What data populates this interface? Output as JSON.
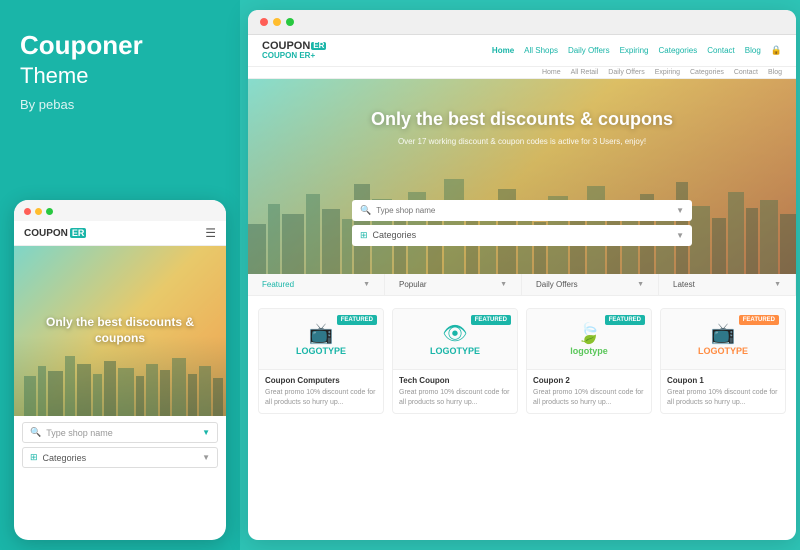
{
  "left": {
    "title": "Couponer",
    "subtitle": "Theme",
    "author": "By pebas"
  },
  "mobile": {
    "logo": "COUPON",
    "logo_er": "ER",
    "hero_text": "Only the best discounts & coupons",
    "search_placeholder": "Type shop name",
    "categories_label": "Categories"
  },
  "desktop": {
    "logo_main": "COUPON",
    "logo_er": "ER",
    "logo_sub": "COUPON ER+",
    "nav_links": [
      "Home",
      "All Shops",
      "Daily Offers",
      "Expiring",
      "Categories",
      "Contact",
      "Blog"
    ],
    "hero_title": "Only the best discounts & coupons",
    "hero_subtitle": "Over 17 working discount & coupon codes is active for 3 Users, enjoy!",
    "search_placeholder": "Type shop name",
    "categories_label": "Categories",
    "filter_tabs": [
      "Featured",
      "Popular",
      "Daily Offers",
      "Latest"
    ],
    "cards": [
      {
        "title": "Coupon Computers",
        "desc": "Great promo 10% discount code for all products so hurry up...",
        "logotype": "LOGOTYPE",
        "logotype_color": "teal",
        "badge": "FEATURED",
        "badge_color": "teal"
      },
      {
        "title": "Tech Coupon",
        "desc": "Great promo 10% discount code for all products so hurry up...",
        "logotype": "LOGOTYPE",
        "logotype_color": "teal",
        "badge": "FEATURED",
        "badge_color": "teal"
      },
      {
        "title": "Coupon 2",
        "desc": "Great promo 10% discount code for all products so hurry up...",
        "logotype": "logotype",
        "logotype_color": "green",
        "badge": "FEATURED",
        "badge_color": "teal"
      },
      {
        "title": "Coupon 1",
        "desc": "Great promo 10% discount code for all products so hurry up...",
        "logotype": "LOGOTYPE",
        "logotype_color": "orange",
        "badge": "FEATURED",
        "badge_color": "orange"
      }
    ]
  }
}
